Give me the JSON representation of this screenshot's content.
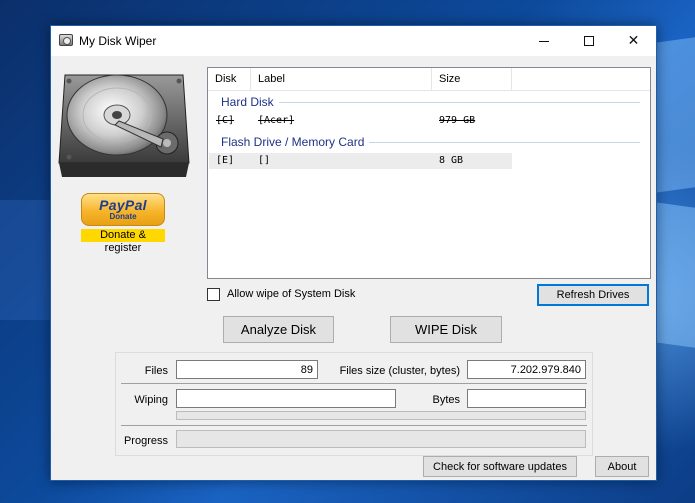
{
  "window": {
    "title": "My Disk Wiper",
    "icon": "hard-disk-icon"
  },
  "titlebar": {
    "minimize_icon": "minimize-icon",
    "maximize_icon": "maximize-icon",
    "close_icon": "close-icon"
  },
  "sidebar": {
    "image": "hard-disk-illustration",
    "paypal": {
      "brand": "PayPal",
      "sub": "Donate"
    },
    "donate_label": "Donate & register"
  },
  "drive_list": {
    "columns": [
      "Disk",
      "Label",
      "Size"
    ],
    "groups": [
      {
        "name": "Hard Disk",
        "rows": [
          {
            "disk": "[C]",
            "label": "[Acer]",
            "size": "979 GB",
            "disabled": true
          }
        ]
      },
      {
        "name": "Flash Drive / Memory Card",
        "rows": [
          {
            "disk": "[E]",
            "label": "[]",
            "size": "8 GB",
            "disabled": false
          }
        ]
      }
    ]
  },
  "options": {
    "allow_system_wipe_label": "Allow wipe of System Disk",
    "allow_system_wipe_checked": false
  },
  "buttons": {
    "refresh": "Refresh Drives",
    "analyze": "Analyze Disk",
    "wipe": "WIPE Disk",
    "updates": "Check for software updates",
    "about": "About"
  },
  "stats": {
    "files_label": "Files",
    "files_value": "89",
    "files_size_label": "Files size (cluster, bytes)",
    "files_size_value": "7.202.979.840",
    "wiping_label": "Wiping",
    "wiping_value": "",
    "bytes_label": "Bytes",
    "bytes_value": "",
    "progress_label": "Progress",
    "wiping_progress": 0,
    "overall_progress": 0
  },
  "colors": {
    "accent": "#0078d7",
    "group_header": "#1e3287",
    "donate_highlight": "#ffd800"
  }
}
